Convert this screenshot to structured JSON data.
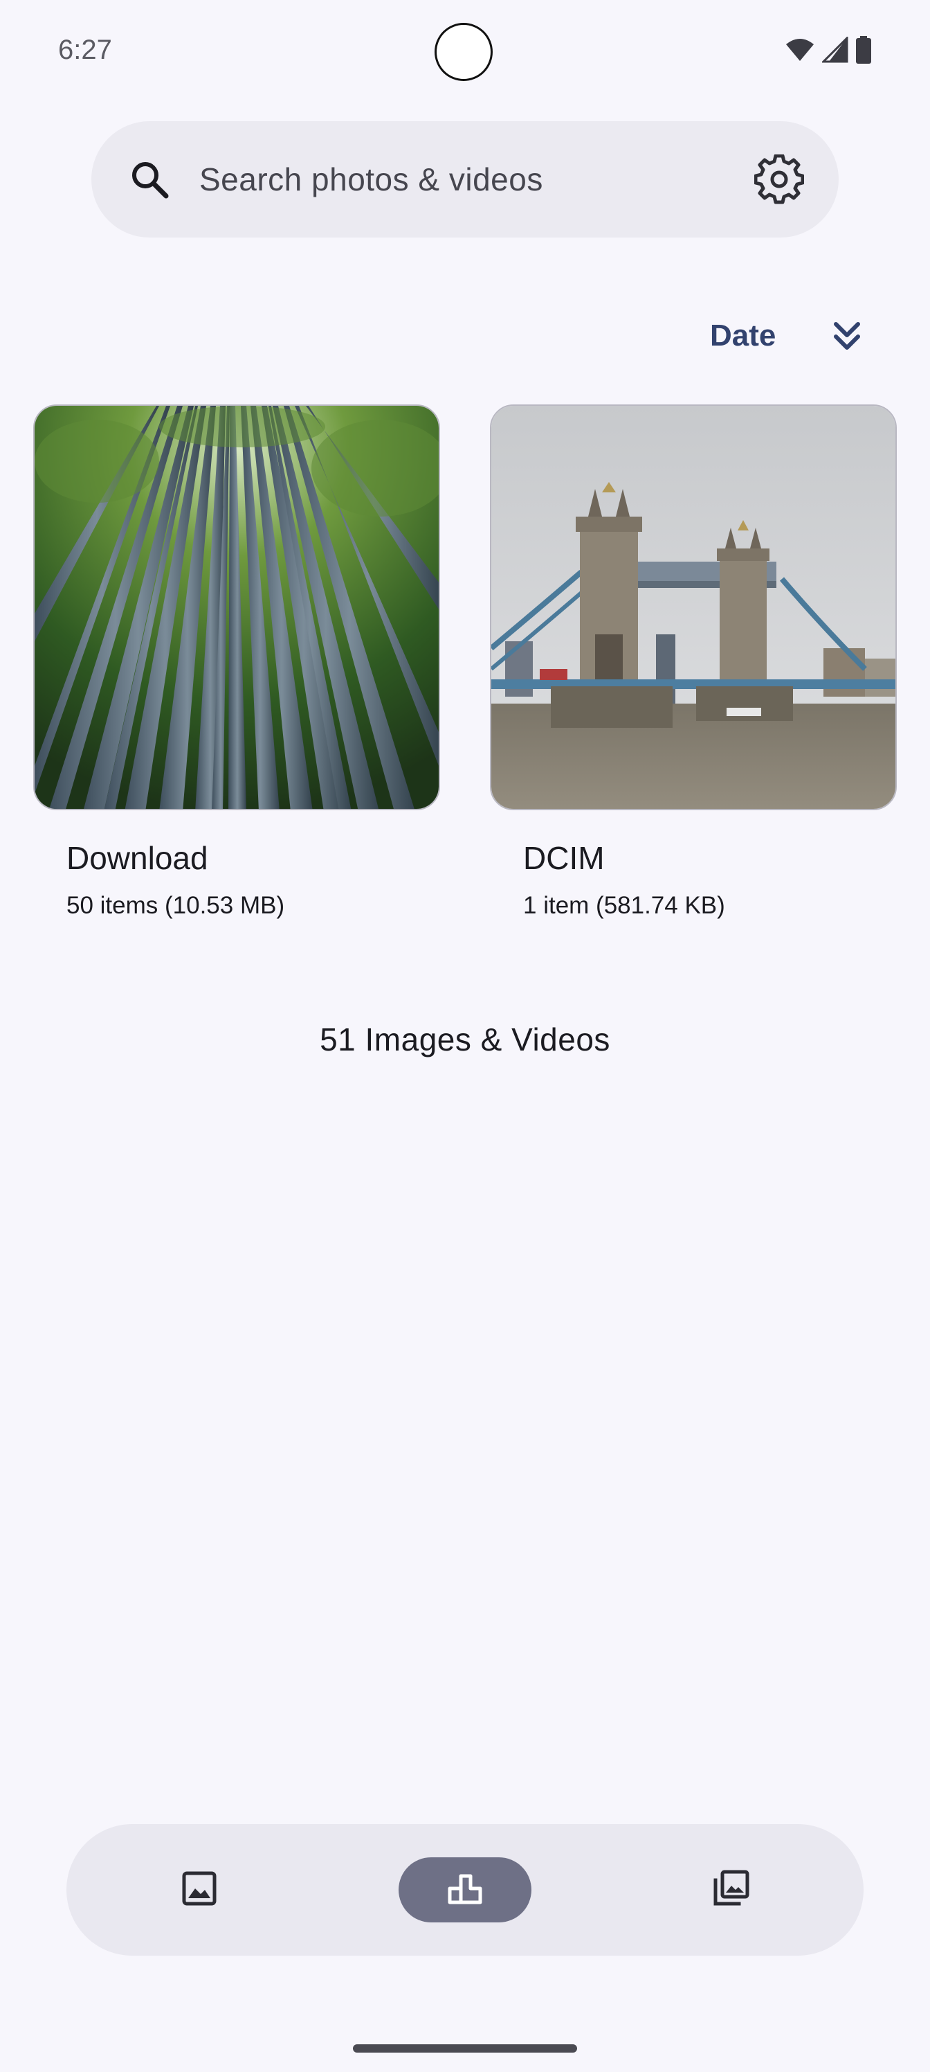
{
  "status_bar": {
    "time": "6:27",
    "icons": [
      "wifi-icon",
      "signal-icon",
      "battery-icon"
    ]
  },
  "search": {
    "placeholder": "Search photos & videos",
    "search_icon": "search-icon",
    "settings_icon": "gear-icon"
  },
  "sort": {
    "label": "Date",
    "icon": "double-chevron-down-icon"
  },
  "albums": [
    {
      "name": "Download",
      "meta": "50 items (10.53 MB)",
      "thumbnail": "bamboo-forest"
    },
    {
      "name": "DCIM",
      "meta": "1 item (581.74 KB)",
      "thumbnail": "tower-bridge"
    }
  ],
  "summary": "51 Images & Videos",
  "bottom_nav": {
    "items": [
      {
        "icon": "image-icon",
        "active": false
      },
      {
        "icon": "albums-icon",
        "active": true
      },
      {
        "icon": "library-icon",
        "active": false
      }
    ]
  },
  "colors": {
    "background": "#f7f6fc",
    "accent": "#32426e",
    "nav_active": "#6e7086",
    "surface": "#ebeaf1"
  }
}
